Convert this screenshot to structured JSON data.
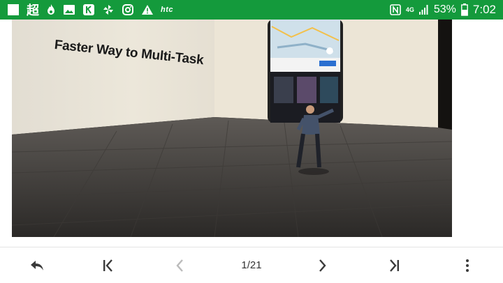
{
  "status_bar": {
    "carrier_logo": "htc",
    "kanji": "超",
    "network": "4G",
    "battery": "53%",
    "time": "7:02",
    "color": "#149a3c"
  },
  "slide": {
    "title": "Faster Way to Multi-Task"
  },
  "viewer": {
    "page_counter": "1/21"
  },
  "icons": [
    "reply-icon",
    "first-page-icon",
    "prev-icon",
    "next-icon",
    "last-page-icon",
    "more-icon"
  ]
}
